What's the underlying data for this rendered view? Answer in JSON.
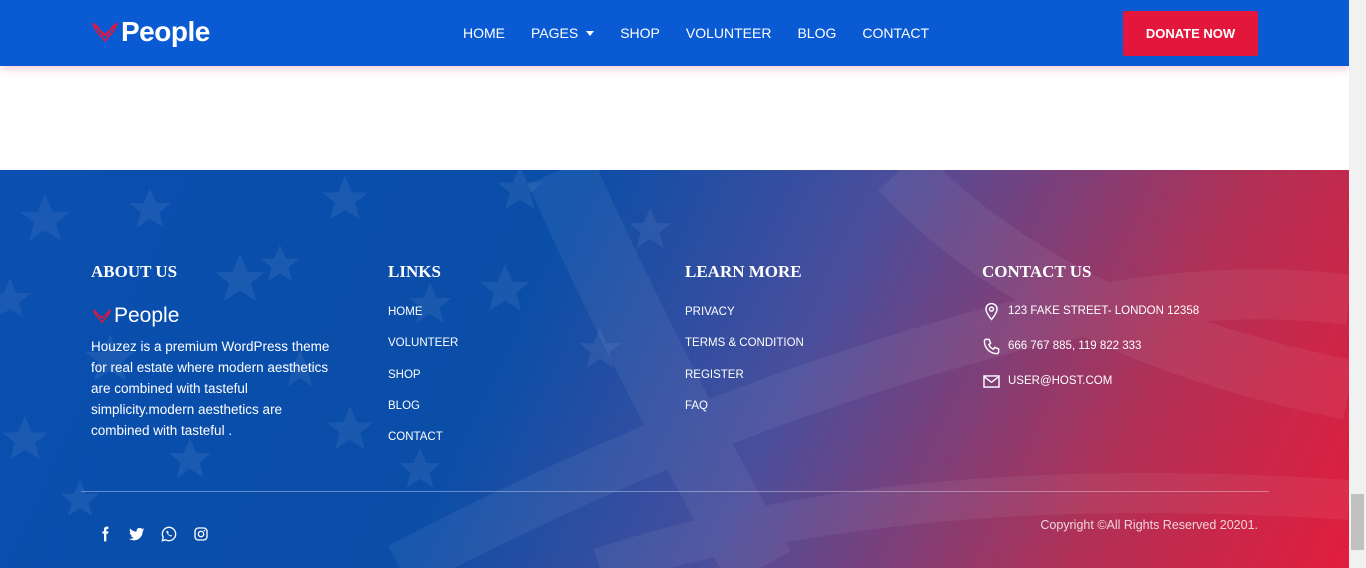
{
  "header": {
    "logo_text": "People",
    "nav": [
      "HOME",
      "PAGES",
      "SHOP",
      "VOLUNTEER",
      "BLOG",
      "CONTACT"
    ],
    "donate_label": "DONATE NOW"
  },
  "footer": {
    "about": {
      "title": "ABOUT US",
      "logo_text": "People",
      "text": "Houzez is a premium WordPress theme for real estate where modern aesthetics are combined with tasteful simplicity.modern aesthetics are combined with tasteful ."
    },
    "links": {
      "title": "LINKS",
      "items": [
        "HOME",
        "VOLUNTEER",
        "SHOP",
        "BLOG",
        "CONTACT"
      ]
    },
    "learn_more": {
      "title": "LEARN MORE",
      "items": [
        "PRIVACY",
        "TERMS & CONDITION",
        "REGISTER",
        "FAQ"
      ]
    },
    "contact": {
      "title": "CONTACT US",
      "address": "123 FAKE STREET- LONDON 12358",
      "phone": "666 767 885, 119 822 333",
      "email": "USER@HOST.COM"
    },
    "social": [
      "facebook-icon",
      "twitter-icon",
      "whatsapp-icon",
      "instagram-icon"
    ],
    "copyright": "Copyright ©All Rights Reserved 20201."
  },
  "colors": {
    "header_bg": "#0a5bd3",
    "accent_red": "#e3173c",
    "footer_blue": "#0b4fb0"
  }
}
